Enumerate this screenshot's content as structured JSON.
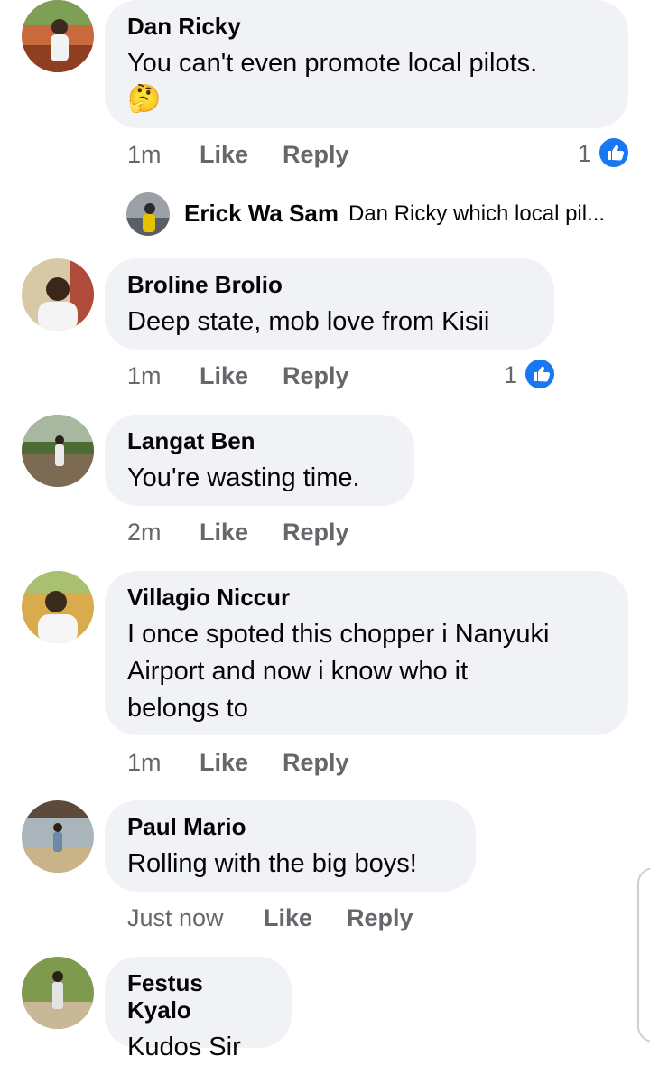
{
  "comments": [
    {
      "author": "Dan Ricky",
      "text": "You can't even promote local pilots.",
      "emoji": "🤔",
      "time": "1m",
      "like_label": "Like",
      "reply_label": "Reply",
      "reaction_count": "1",
      "avatar_colors": [
        "#b5562a",
        "#7a9c4f"
      ]
    },
    {
      "author": "Broline Brolio",
      "text": "Deep state, mob love from Kisii",
      "time": "1m",
      "like_label": "Like",
      "reply_label": "Reply",
      "reaction_count": "1",
      "avatar_colors": [
        "#d9c9a8",
        "#3b2a1e"
      ]
    },
    {
      "author": "Langat Ben",
      "text": "You're wasting time.",
      "time": "2m",
      "like_label": "Like",
      "reply_label": "Reply",
      "avatar_colors": [
        "#8a6a4a",
        "#5c7a3a"
      ]
    },
    {
      "author": "Villagio Niccur",
      "text": "I once spoted this chopper i Nanyuki Airport and now i know who it belongs to",
      "line1": "I once spoted this chopper i Nanyuki",
      "line2": "Airport and now i know who it",
      "line3": "belongs to",
      "time": "1m",
      "like_label": "Like",
      "reply_label": "Reply",
      "avatar_colors": [
        "#d6a84a",
        "#4a3a2a"
      ]
    },
    {
      "author": "Paul Mario",
      "text": "Rolling with the big boys!",
      "time": "Just now",
      "like_label": "Like",
      "reply_label": "Reply",
      "avatar_colors": [
        "#9aa7b0",
        "#6e5a44"
      ]
    },
    {
      "author": "Festus Kyalo",
      "text": "Kudos Sir",
      "avatar_colors": [
        "#7c9a4c",
        "#c9b89a"
      ]
    }
  ],
  "reply_preview": {
    "author": "Erick Wa Sam",
    "text": "Dan Ricky which local pil..."
  },
  "colors": {
    "bubble": "#f0f2f5",
    "secondary_text": "#65676b",
    "like_blue": "#1877f2"
  },
  "icons": {
    "reaction": "thumbs-up-icon"
  }
}
